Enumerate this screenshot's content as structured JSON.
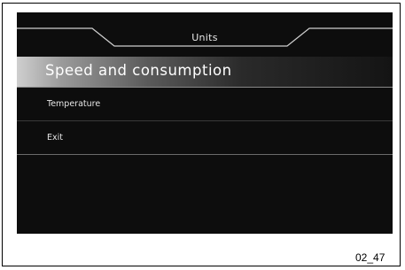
{
  "screen": {
    "title": "Units",
    "menu": [
      {
        "label": "Speed and consumption",
        "selected": true
      },
      {
        "label": "Temperature",
        "selected": false
      },
      {
        "label": "Exit",
        "selected": false
      }
    ]
  },
  "figure_code": "02_47",
  "colors": {
    "screen_bg": "#0d0d0d",
    "text": "#e6e6e6",
    "frame_line": "#000000"
  }
}
